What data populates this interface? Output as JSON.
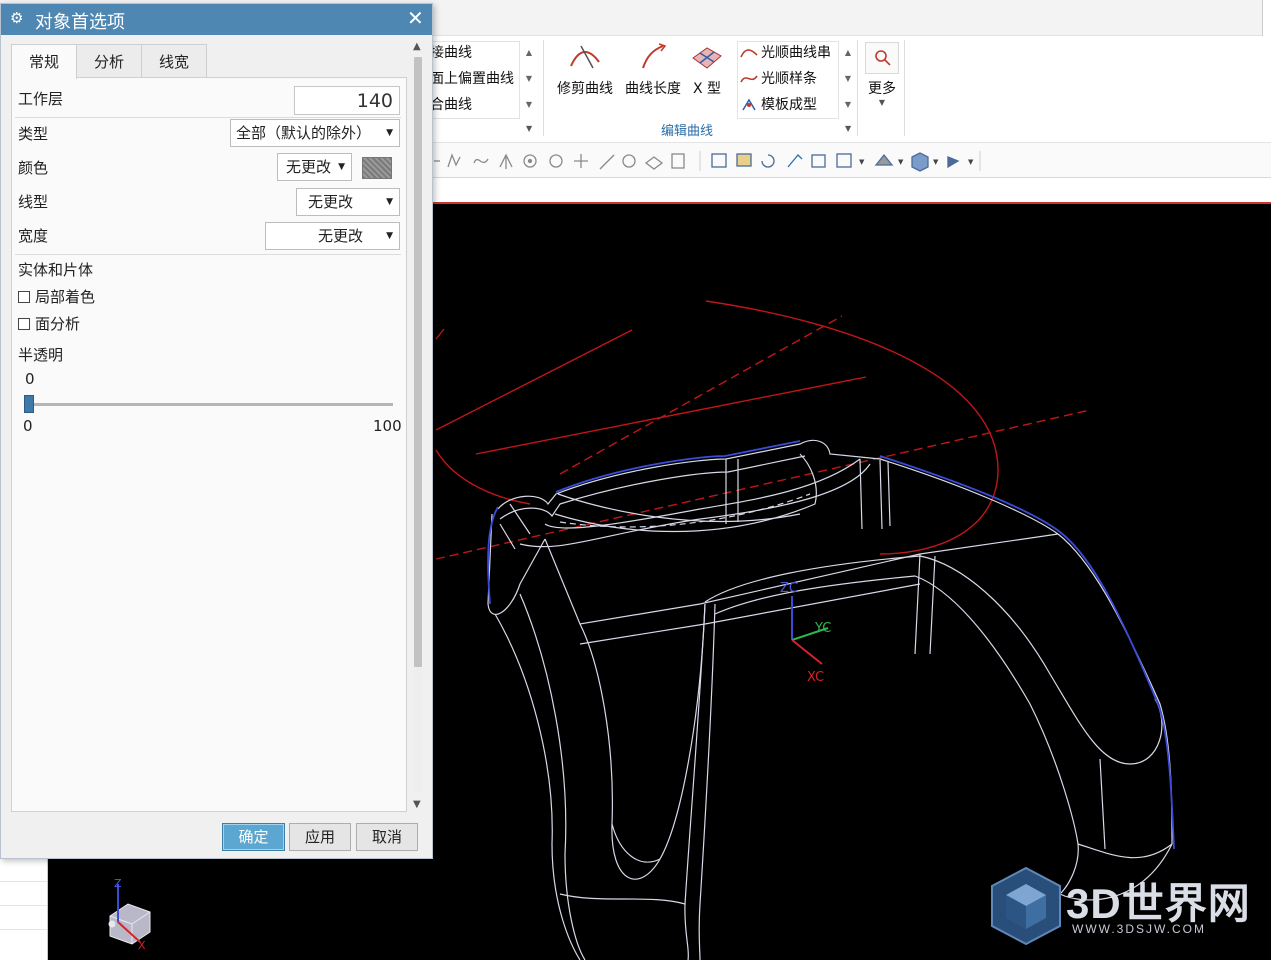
{
  "dialog": {
    "title": "对象首选项",
    "close_glyph": "✕",
    "tabs": [
      {
        "label": "常规",
        "active": true
      },
      {
        "label": "分析",
        "active": false
      },
      {
        "label": "线宽",
        "active": false
      }
    ],
    "fields": {
      "work_layer_label": "工作层",
      "work_layer_value": "140",
      "type_label": "类型",
      "type_value": "全部（默认的除外）",
      "color_label": "颜色",
      "color_value": "无更改",
      "linetype_label": "线型",
      "linetype_value": "无更改",
      "width_label": "宽度",
      "width_value": "无更改"
    },
    "solid_section": {
      "heading": "实体和片体",
      "partial_shading": {
        "label": "局部着色",
        "checked": false
      },
      "face_analysis": {
        "label": "面分析",
        "checked": false
      }
    },
    "translucency": {
      "heading": "半透明",
      "current": "0",
      "min": "0",
      "max": "100",
      "value": 0
    },
    "buttons": {
      "ok": "确定",
      "apply": "应用",
      "cancel": "取消"
    }
  },
  "ribbon": {
    "list1": [
      "接曲线",
      "面上偏置曲线",
      "合曲线"
    ],
    "big_buttons": [
      "修剪曲线",
      "曲线长度",
      "X 型"
    ],
    "list2": [
      "光顺曲线串",
      "光顺样条",
      "模板成型"
    ],
    "more": "更多",
    "group_label": "编辑曲线"
  },
  "viewport": {
    "triad": {
      "zc": "ZC",
      "yc": "YC",
      "xc": "XC"
    },
    "mini_triad": {
      "z": "Z",
      "x": "X"
    }
  },
  "watermark": {
    "brand": "3D世界网",
    "url": "WWW.3DSJW.COM"
  },
  "colors": {
    "title_bar": "#4f87b3",
    "primary_button": "#5ba7d1",
    "wire": "#d8d8e8",
    "edge_blue": "#3b4bd8",
    "curve_red": "#c0161a"
  }
}
